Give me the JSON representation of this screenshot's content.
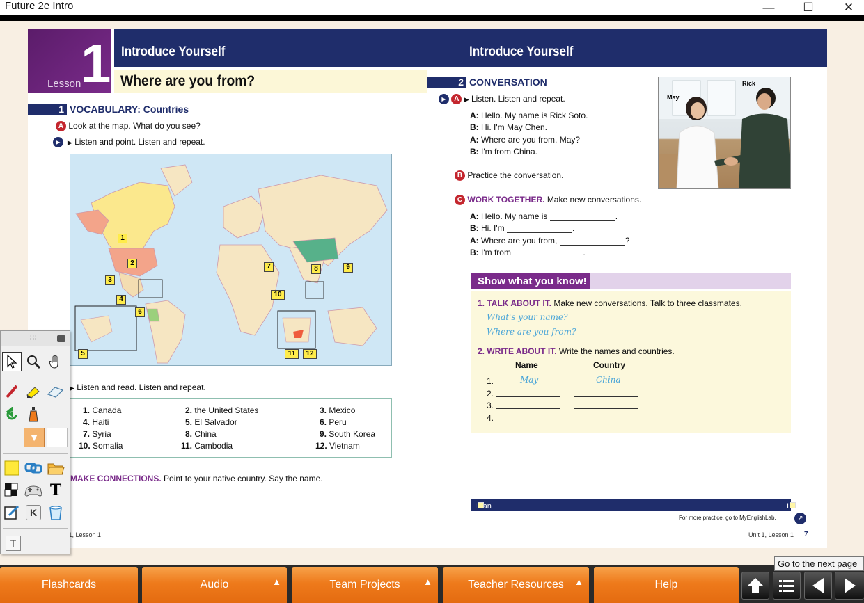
{
  "window": {
    "title": "Future 2e Intro",
    "minimize": "—",
    "maximize": "☐",
    "close": "✕"
  },
  "left_page": {
    "lesson_label": "Lesson",
    "lesson_number": "1",
    "header": "Introduce Yourself",
    "subtitle": "Where are you from?",
    "section1": {
      "num": "1",
      "title": "VOCABULARY: Countries",
      "stepA_letter": "A",
      "stepA_text": "Look at the map. What do you see?",
      "listen_point": "Listen and point. Listen and repeat.",
      "listen_read": "Listen and read. Listen and repeat."
    },
    "map_labels": [
      "1",
      "2",
      "3",
      "4",
      "5",
      "6",
      "7",
      "8",
      "9",
      "10",
      "11",
      "12"
    ],
    "words": [
      {
        "n": "1.",
        "w": "Canada"
      },
      {
        "n": "2.",
        "w": "the United States"
      },
      {
        "n": "3.",
        "w": "Mexico"
      },
      {
        "n": "4.",
        "w": "Haiti"
      },
      {
        "n": "5.",
        "w": "El Salvador"
      },
      {
        "n": "6.",
        "w": "Peru"
      },
      {
        "n": "7.",
        "w": "Syria"
      },
      {
        "n": "8.",
        "w": "China"
      },
      {
        "n": "9.",
        "w": "South Korea"
      },
      {
        "n": "10.",
        "w": "Somalia"
      },
      {
        "n": "11.",
        "w": "Cambodia"
      },
      {
        "n": "12.",
        "w": "Vietnam"
      }
    ],
    "make_connections_head": "MAKE CONNECTIONS.",
    "make_connections_text": "Point to your native country. Say the name.",
    "footer": "Unit 1, Lesson 1"
  },
  "right_page": {
    "header": "Introduce Yourself",
    "section2": {
      "num": "2",
      "title": "CONVERSATION",
      "a_letter": "A",
      "a_text": "Listen. Listen and repeat.",
      "dialog": [
        {
          "s": "A:",
          "t": "Hello. My name is Rick Soto."
        },
        {
          "s": "B:",
          "t": "Hi. I'm May Chen."
        },
        {
          "s": "A:",
          "t": "Where are you from, May?"
        },
        {
          "s": "B:",
          "t": "I'm from China."
        }
      ],
      "b_letter": "B",
      "b_text": "Practice the conversation.",
      "c_letter": "C",
      "c_head": "WORK TOGETHER.",
      "c_text": "Make new conversations.",
      "work": [
        {
          "s": "A:",
          "t": "Hello. My name is",
          "end": "."
        },
        {
          "s": "B:",
          "t": "Hi. I'm",
          "end": "."
        },
        {
          "s": "A:",
          "t": "Where are you from,",
          "end": "?"
        },
        {
          "s": "B:",
          "t": "I'm from",
          "end": "."
        }
      ]
    },
    "photo_labels": {
      "left": "May",
      "right": "Rick"
    },
    "swyk": {
      "title": "Show what you know!",
      "item1_head": "1. TALK ABOUT IT.",
      "item1_text": "Make new conversations. Talk to three classmates.",
      "hand1": "What's your name?",
      "hand2": "Where are you from?",
      "item2_head": "2. WRITE ABOUT IT.",
      "item2_text": "Write the names and countries.",
      "col_name": "Name",
      "col_country": "Country",
      "rows": [
        {
          "n": "1.",
          "name": "May",
          "country": "China"
        },
        {
          "n": "2.",
          "name": "",
          "country": ""
        },
        {
          "n": "3.",
          "name": "",
          "country": ""
        },
        {
          "n": "4.",
          "name": "",
          "country": ""
        }
      ]
    },
    "can_do": "I can introduce myself.",
    "need_practice": "I need more practice.",
    "more_practice": "For more practice, go to MyEnglishLab.",
    "footer": "Unit 1, Lesson 1",
    "page_num": "7"
  },
  "toolbox": {
    "text_tool_glyph": "T",
    "key_glyph": "K"
  },
  "nav": {
    "buttons": [
      "Flashcards",
      "Audio",
      "Team Projects",
      "Teacher Resources",
      "Help"
    ],
    "tooltip": "Go to the next page"
  },
  "colors": {
    "navy": "#1f2d6b",
    "purple": "#7a2b8a",
    "red": "#c4262e",
    "orange": "#ee7a1b"
  }
}
